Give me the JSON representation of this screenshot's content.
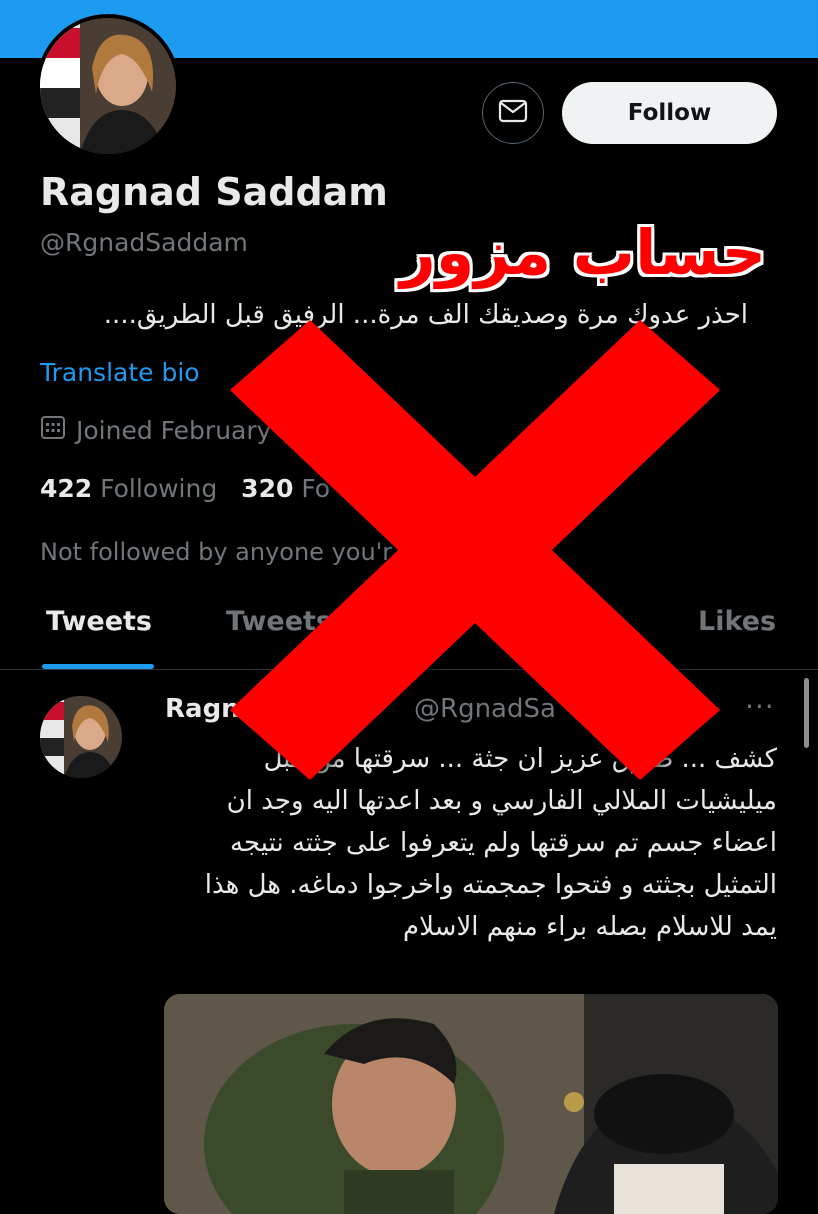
{
  "colors": {
    "accent": "#1d9bf0",
    "background": "#000000",
    "muted": "#71767b",
    "overlay_red": "#ff0000"
  },
  "profile": {
    "display_name": "Ragnad Saddam",
    "handle": "@RgnadSaddam",
    "bio": "احذر عدوك مرة وصديقك الف مرة... الرفيق قبل الطريق....",
    "translate_label": "Translate bio",
    "joined": "Joined February",
    "calendar_icon": "calendar-icon",
    "following_count": "422",
    "following_label": "Following",
    "followers_count": "320",
    "followers_label": "Fo",
    "not_followed": "Not followed by anyone you'r"
  },
  "actions": {
    "mail_icon": "envelope-icon",
    "follow_label": "Follow"
  },
  "tabs": [
    {
      "label": "Tweets",
      "active": true
    },
    {
      "label": "Tweets &",
      "active": false
    },
    {
      "label": "ia",
      "active": false
    },
    {
      "label": "Likes",
      "active": false
    }
  ],
  "tweet": {
    "name": "Ragnad",
    "handle": "@RgnadSa",
    "more_label": "···",
    "text": "كشف ... طارق عزيز ان جثة ... سرقتها من قبل ميليشيات الملالي الفارسي و بعد اعدتها اليه وجد ان اعضاء جسم تم سرقتها ولم يتعرفوا على جثته نتيجه التمثيل بجثته و فتحوا جمجمته واخرجوا دماغه. هل هذا يمد للاسلام بصله براء منهم الاسلام"
  },
  "overlay": {
    "title": "حساب مزور",
    "mark": "x-mark"
  }
}
